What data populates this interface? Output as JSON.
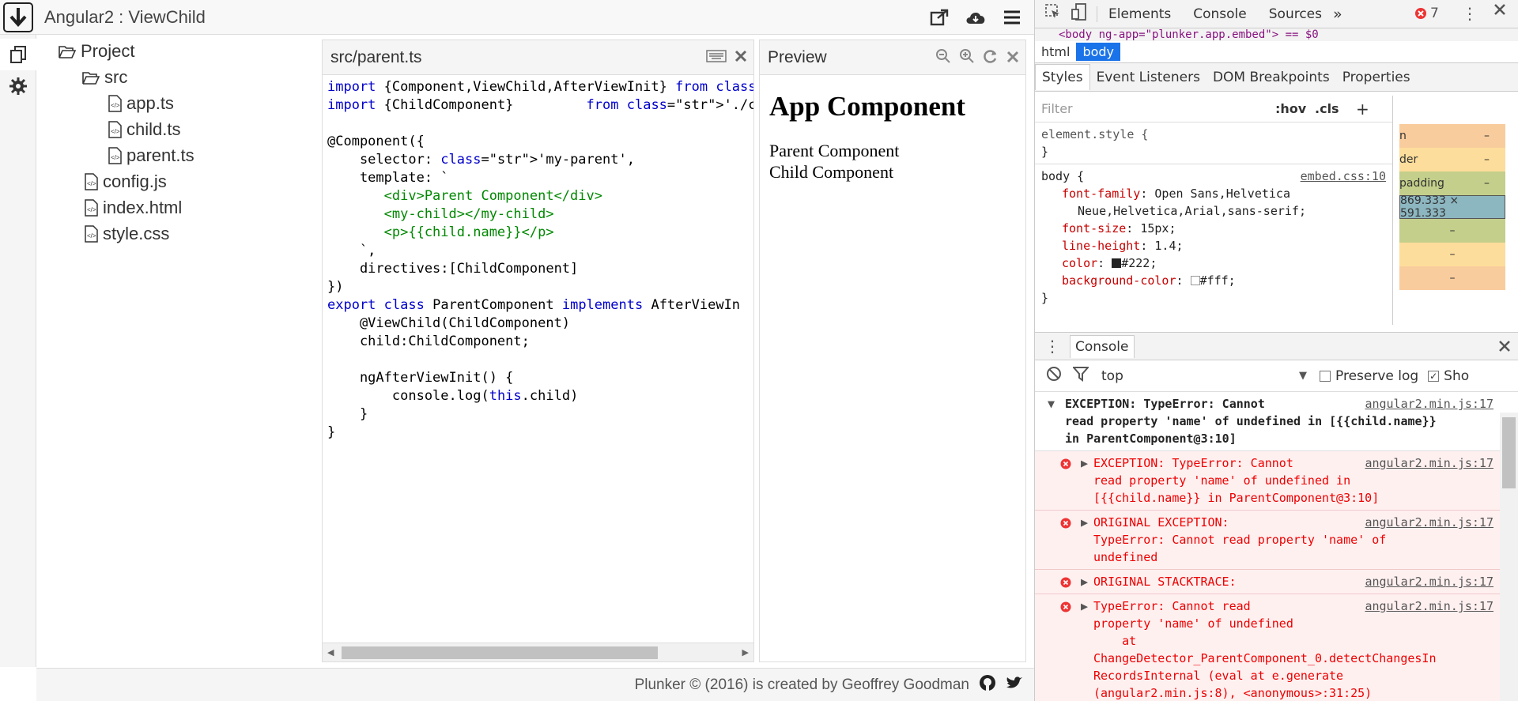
{
  "header": {
    "title": "Angular2 : ViewChild"
  },
  "tree": {
    "project": "Project",
    "src": "src",
    "files": [
      "app.ts",
      "child.ts",
      "parent.ts"
    ],
    "root_files": [
      "config.js",
      "index.html",
      "style.css"
    ]
  },
  "editor": {
    "filename": "src/parent.ts",
    "lines": [
      "import {Component,ViewChild,AfterViewInit} from 'an",
      "import {ChildComponent}         from './child';",
      "",
      "@Component({",
      "    selector: 'my-parent',",
      "    template: `",
      "       <div>Parent Component</div>",
      "       <my-child></my-child>",
      "       <p>{{child.name}}</p>",
      "    `,",
      "    directives:[ChildComponent]",
      "})",
      "export class ParentComponent implements AfterViewIn",
      "    @ViewChild(ChildComponent)",
      "    child:ChildComponent;",
      "",
      "    ngAfterViewInit() {",
      "        console.log(this.child)",
      "    }",
      "}"
    ]
  },
  "preview": {
    "title": "Preview",
    "h1": "App Component",
    "lines": [
      "Parent Component",
      "Child Component"
    ]
  },
  "footer": {
    "text": "Plunker © (2016) is created by Geoffrey Goodman"
  },
  "devtools": {
    "tabs": [
      "Elements",
      "Console",
      "Sources"
    ],
    "error_count": "7",
    "dom_line": "<body ng-app=\"plunker.app.embed\"> == $0",
    "crumbs": [
      "html",
      "body"
    ],
    "subtabs": [
      "Styles",
      "Event Listeners",
      "DOM Breakpoints",
      "Properties"
    ],
    "filter_placeholder": "Filter",
    "hov": ":hov",
    "cls": ".cls",
    "element_style": "element.style {",
    "close_brace": "}",
    "body_selector": "body {",
    "body_src": "embed.css:10",
    "props": [
      {
        "n": "font-family",
        "v": "Open Sans,Helvetica"
      },
      {
        "n": "",
        "v": "Neue,Helvetica,Arial,sans-serif;"
      },
      {
        "n": "font-size",
        "v": "15px;"
      },
      {
        "n": "line-height",
        "v": "1.4;"
      },
      {
        "n": "color",
        "v": "#222;"
      },
      {
        "n": "background-color",
        "v": "#fff;"
      }
    ],
    "box_model": {
      "size": "869.333 × 591.333",
      "labels": [
        "n",
        "der",
        "padding"
      ],
      "dash": "–"
    },
    "console_tab": "Console",
    "context": "top",
    "preserve_log": "Preserve log",
    "show": "Sho",
    "entries": [
      {
        "text": "EXCEPTION: TypeError: Cannot\nread property 'name' of undefined in [{{child.name}}\nin ParentComponent@3:10]",
        "link": "angular2.min.js:17"
      },
      {
        "text": "EXCEPTION: TypeError: Cannot\nread property 'name' of undefined in\n[{{child.name}} in ParentComponent@3:10]",
        "link": "angular2.min.js:17"
      },
      {
        "text": "ORIGINAL EXCEPTION:\nTypeError: Cannot read property 'name' of\nundefined",
        "link": "angular2.min.js:17"
      },
      {
        "text": "ORIGINAL STACKTRACE:",
        "link": "angular2.min.js:17"
      },
      {
        "text": "TypeError: Cannot read\nproperty 'name' of undefined\n    at\nChangeDetector_ParentComponent_0.detectChangesIn\nRecordsInternal (eval at e.generate\n(angular2.min.js:8), <anonymous>:31:25)",
        "link": "angular2.min.js:17"
      }
    ]
  }
}
